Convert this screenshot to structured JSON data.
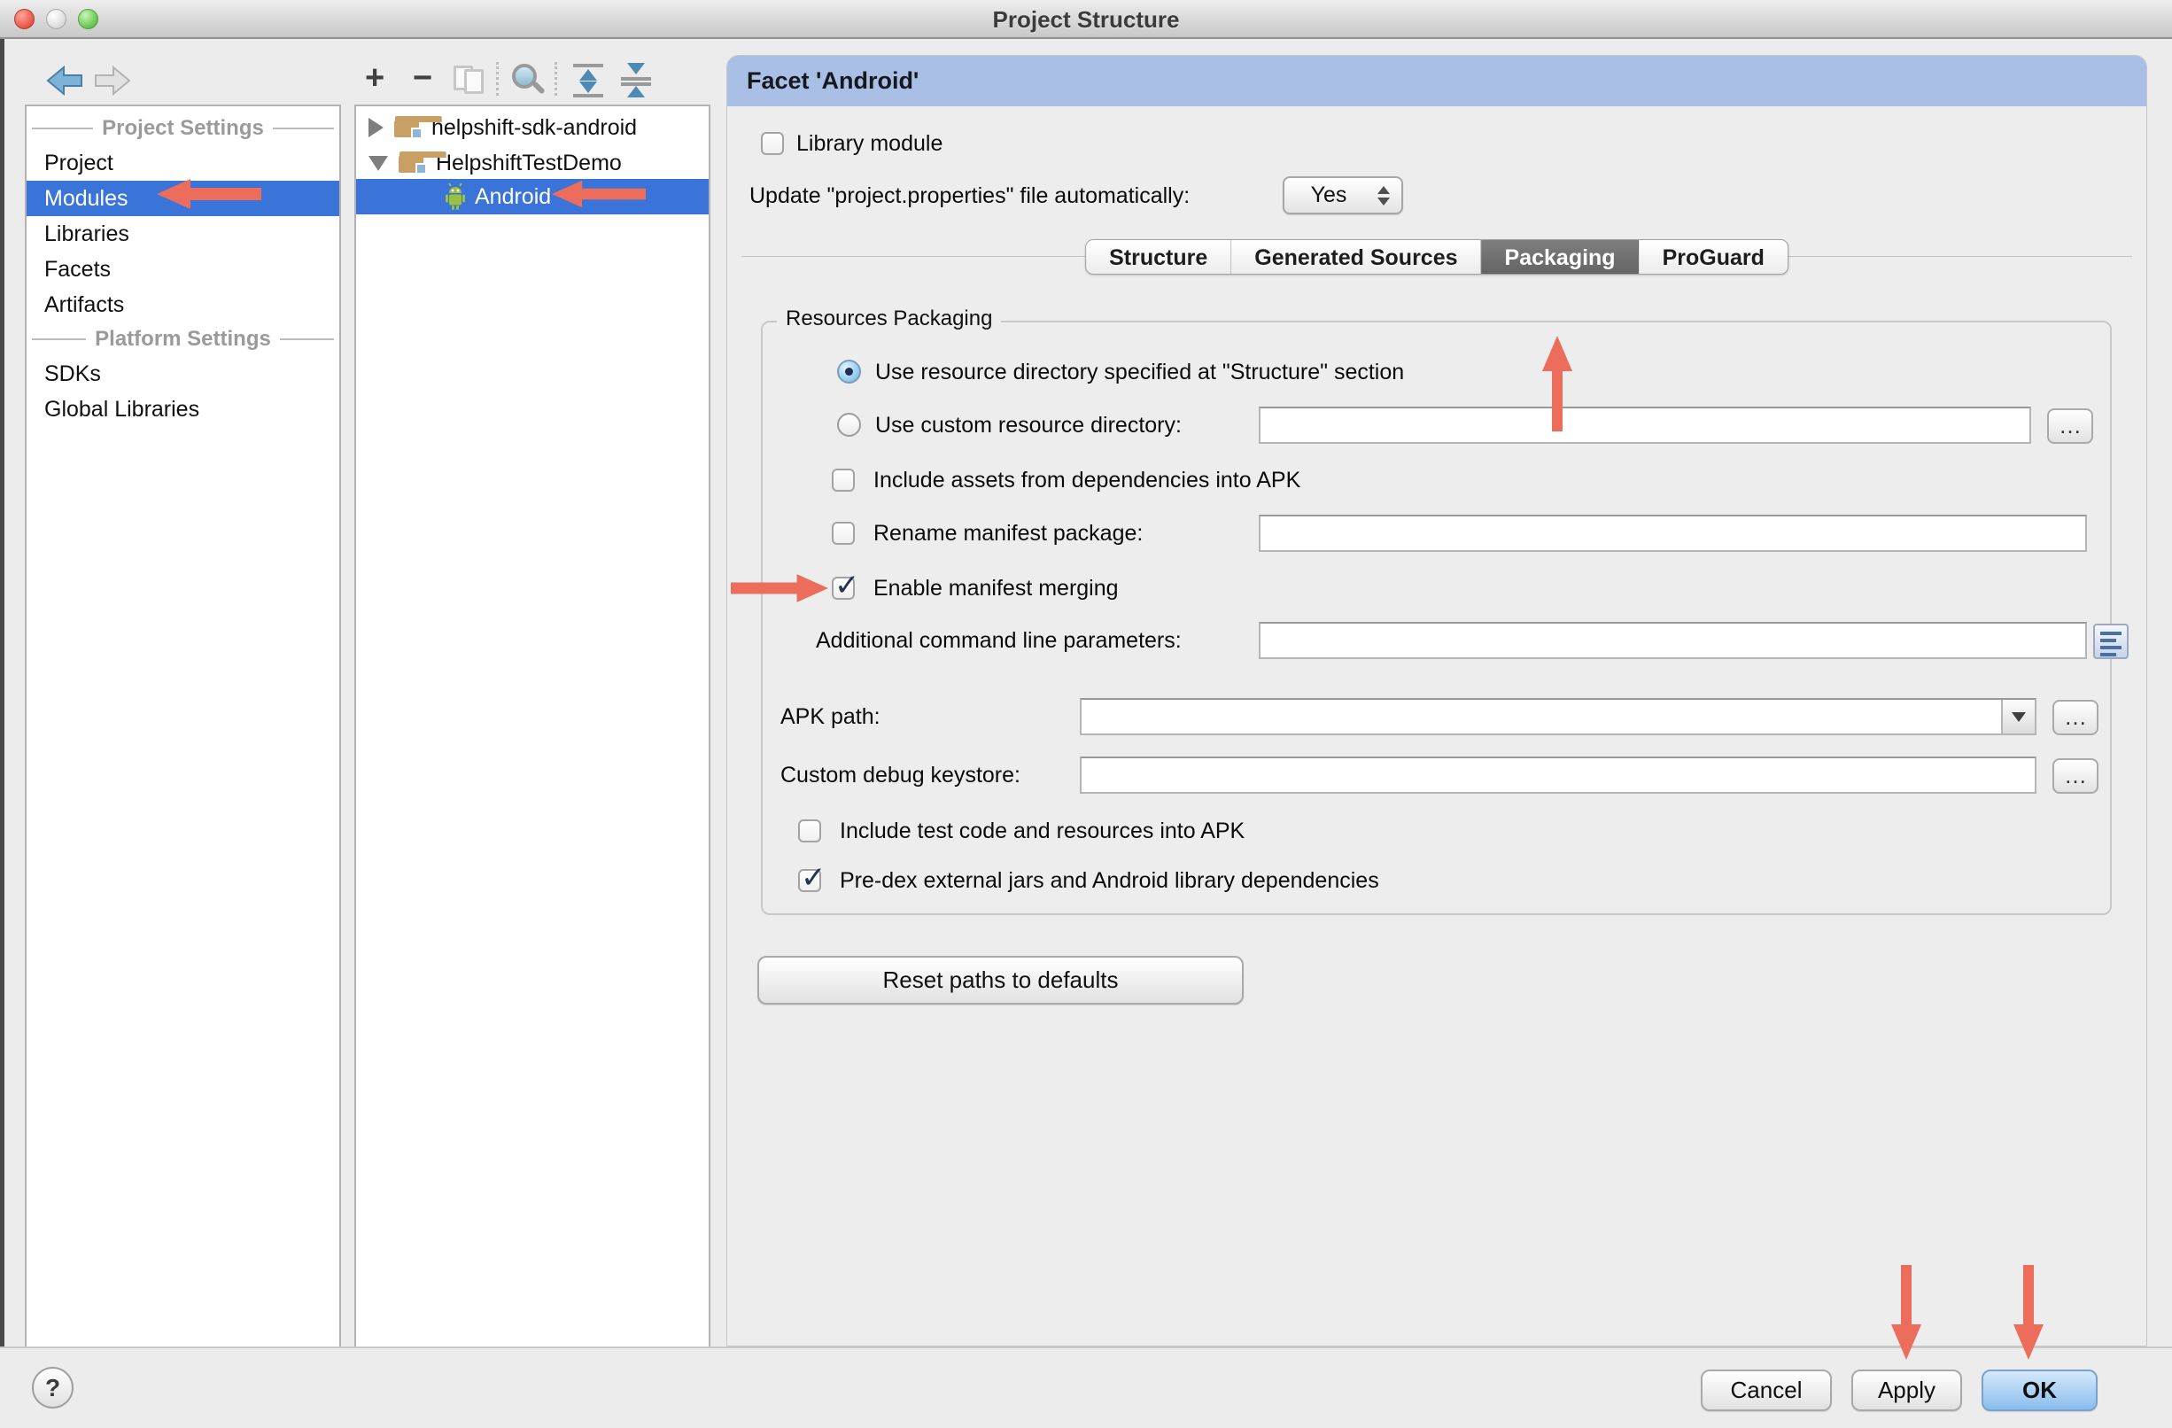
{
  "window": {
    "title": "Project Structure"
  },
  "icons": {
    "check": "✓",
    "plus": "+",
    "minus": "−",
    "ellipsis": "…",
    "help": "?"
  },
  "sidebar": {
    "section1": "Project Settings",
    "section2": "Platform Settings",
    "items1": [
      {
        "label": "Project"
      },
      {
        "label": "Modules",
        "selected": true
      },
      {
        "label": "Libraries"
      },
      {
        "label": "Facets"
      },
      {
        "label": "Artifacts"
      }
    ],
    "items2": [
      {
        "label": "SDKs"
      },
      {
        "label": "Global Libraries"
      }
    ]
  },
  "tree": {
    "items": [
      {
        "label": "helpshift-sdk-android",
        "state": "collapsed"
      },
      {
        "label": "HelpshiftTestDemo",
        "state": "expanded"
      },
      {
        "label": "Android",
        "selected": true
      }
    ]
  },
  "facet": {
    "title": "Facet 'Android'",
    "library_module": "Library module",
    "update_label": "Update \"project.properties\" file automatically:",
    "update_value": "Yes",
    "tabs": [
      {
        "label": "Structure"
      },
      {
        "label": "Generated Sources"
      },
      {
        "label": "Packaging",
        "selected": true
      },
      {
        "label": "ProGuard"
      }
    ],
    "group_title": "Resources Packaging",
    "radio_structure": "Use resource directory specified at \"Structure\" section",
    "radio_custom": "Use custom resource directory:",
    "include_assets": "Include assets from dependencies into APK",
    "rename_manifest": "Rename manifest package:",
    "enable_merging": "Enable manifest merging",
    "additional_params": "Additional command line parameters:",
    "apk_path": "APK path:",
    "keystore": "Custom debug keystore:",
    "include_test": "Include test code and resources into APK",
    "predex": "Pre-dex external jars and Android library dependencies",
    "reset_button": "Reset paths to defaults"
  },
  "footer": {
    "cancel": "Cancel",
    "apply": "Apply",
    "ok": "OK"
  },
  "colors": {
    "selection_blue": "#3b74d8",
    "facet_header_blue": "#a9bfe5",
    "annotation_red": "#ed6d5d",
    "tab_selected_gray": "#6e6e6e",
    "ok_button_blue": "#8abdee"
  }
}
